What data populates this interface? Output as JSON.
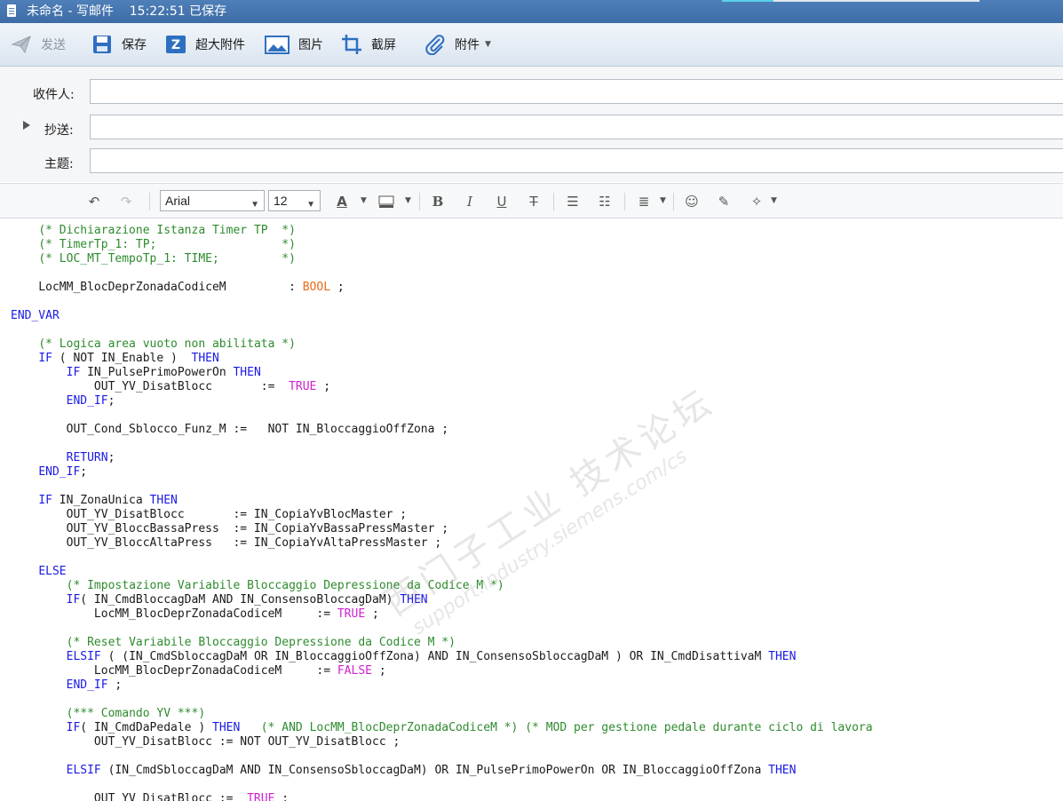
{
  "window": {
    "title": "未命名 - 写邮件",
    "saved_time": "15:22:51 已保存"
  },
  "toolbar": {
    "send": "发送",
    "save": "保存",
    "large_attachment": "超大附件",
    "image": "图片",
    "screenshot": "截屏",
    "attachment": "附件"
  },
  "fields": {
    "to_label": "收件人:",
    "cc_label": "抄送:",
    "subject_label": "主题:"
  },
  "format": {
    "font": "Arial",
    "size": "12"
  },
  "colors": {
    "comment": "#2e8b2e",
    "keyword": "#1a1ae6",
    "type": "#e86a1a",
    "value": "#d020d0"
  },
  "watermark": {
    "cn": "西门子工业 技术论坛",
    "url": "support.industry.siemens.com/cs"
  },
  "code": [
    {
      "segs": [
        [
          "    ",
          ""
        ],
        [
          "(* Dichiarazione Istanza Timer TP  *)",
          "c"
        ]
      ]
    },
    {
      "segs": [
        [
          "    ",
          ""
        ],
        [
          "(* TimerTp_1: TP;                  *)",
          "c"
        ]
      ]
    },
    {
      "segs": [
        [
          "    ",
          ""
        ],
        [
          "(* LOC_MT_TempoTp_1: TIME;         *)",
          "c"
        ]
      ]
    },
    {
      "segs": [
        [
          "",
          ""
        ]
      ]
    },
    {
      "segs": [
        [
          "    LocMM_BlocDeprZonadaCodiceM         : ",
          ""
        ],
        [
          "BOOL",
          "t"
        ],
        [
          " ;",
          ""
        ]
      ]
    },
    {
      "segs": [
        [
          "",
          ""
        ]
      ]
    },
    {
      "segs": [
        [
          "END_VAR",
          "k"
        ]
      ]
    },
    {
      "segs": [
        [
          "",
          ""
        ]
      ]
    },
    {
      "segs": [
        [
          "    ",
          ""
        ],
        [
          "(* Logica area vuoto non abilitata *)",
          "c"
        ]
      ]
    },
    {
      "segs": [
        [
          "    ",
          ""
        ],
        [
          "IF",
          "k"
        ],
        [
          " ( NOT IN_Enable )  ",
          ""
        ],
        [
          "THEN",
          "k"
        ]
      ]
    },
    {
      "segs": [
        [
          "        ",
          ""
        ],
        [
          "IF",
          "k"
        ],
        [
          " IN_PulsePrimoPowerOn ",
          ""
        ],
        [
          "THEN",
          "k"
        ]
      ]
    },
    {
      "segs": [
        [
          "            OUT_YV_DisatBlocc       :=  ",
          ""
        ],
        [
          "TRUE",
          "v"
        ],
        [
          " ;",
          ""
        ]
      ]
    },
    {
      "segs": [
        [
          "        ",
          ""
        ],
        [
          "END_IF",
          "k"
        ],
        [
          ";",
          ""
        ]
      ]
    },
    {
      "segs": [
        [
          "",
          ""
        ]
      ]
    },
    {
      "segs": [
        [
          "        OUT_Cond_Sblocco_Funz_M :=   NOT IN_BloccaggioOffZona ;",
          ""
        ]
      ]
    },
    {
      "segs": [
        [
          "",
          ""
        ]
      ]
    },
    {
      "segs": [
        [
          "        ",
          ""
        ],
        [
          "RETURN",
          "k"
        ],
        [
          ";",
          ""
        ]
      ]
    },
    {
      "segs": [
        [
          "    ",
          ""
        ],
        [
          "END_IF",
          "k"
        ],
        [
          ";",
          ""
        ]
      ]
    },
    {
      "segs": [
        [
          "",
          ""
        ]
      ]
    },
    {
      "segs": [
        [
          "    ",
          ""
        ],
        [
          "IF",
          "k"
        ],
        [
          " IN_ZonaUnica ",
          ""
        ],
        [
          "THEN",
          "k"
        ]
      ]
    },
    {
      "segs": [
        [
          "        OUT_YV_DisatBlocc       := IN_CopiaYvBlocMaster ;",
          ""
        ]
      ]
    },
    {
      "segs": [
        [
          "        OUT_YV_BloccBassaPress  := IN_CopiaYvBassaPressMaster ;",
          ""
        ]
      ]
    },
    {
      "segs": [
        [
          "        OUT_YV_BloccAltaPress   := IN_CopiaYvAltaPressMaster ;",
          ""
        ]
      ]
    },
    {
      "segs": [
        [
          "",
          ""
        ]
      ]
    },
    {
      "segs": [
        [
          "    ",
          ""
        ],
        [
          "ELSE",
          "k"
        ]
      ]
    },
    {
      "segs": [
        [
          "        ",
          ""
        ],
        [
          "(* Impostazione Variabile Bloccaggio Depressione da Codice M *)",
          "c"
        ]
      ]
    },
    {
      "segs": [
        [
          "        ",
          ""
        ],
        [
          "IF",
          "k"
        ],
        [
          "( IN_CmdBloccagDaM AND IN_ConsensoBloccagDaM) ",
          ""
        ],
        [
          "THEN",
          "k"
        ]
      ]
    },
    {
      "segs": [
        [
          "            LocMM_BlocDeprZonadaCodiceM     := ",
          ""
        ],
        [
          "TRUE",
          "v"
        ],
        [
          " ;",
          ""
        ]
      ]
    },
    {
      "segs": [
        [
          "",
          ""
        ]
      ]
    },
    {
      "segs": [
        [
          "        ",
          ""
        ],
        [
          "(* Reset Variabile Bloccaggio Depressione da Codice M *)",
          "c"
        ]
      ]
    },
    {
      "segs": [
        [
          "        ",
          ""
        ],
        [
          "ELSIF",
          "k"
        ],
        [
          " ( (IN_CmdSbloccagDaM OR IN_BloccaggioOffZona) AND IN_ConsensoSbloccagDaM ) OR IN_CmdDisattivaM ",
          ""
        ],
        [
          "THEN",
          "k"
        ]
      ]
    },
    {
      "segs": [
        [
          "            LocMM_BlocDeprZonadaCodiceM     := ",
          ""
        ],
        [
          "FALSE",
          "v"
        ],
        [
          " ;",
          ""
        ]
      ]
    },
    {
      "segs": [
        [
          "        ",
          ""
        ],
        [
          "END_IF",
          "k"
        ],
        [
          " ;",
          ""
        ]
      ]
    },
    {
      "segs": [
        [
          "",
          ""
        ]
      ]
    },
    {
      "segs": [
        [
          "        ",
          ""
        ],
        [
          "(*** Comando YV ***)",
          "c"
        ]
      ]
    },
    {
      "segs": [
        [
          "        ",
          ""
        ],
        [
          "IF",
          "k"
        ],
        [
          "( IN_CmdDaPedale ) ",
          ""
        ],
        [
          "THEN",
          "k"
        ],
        [
          "   ",
          ""
        ],
        [
          "(* AND LocMM_BlocDeprZonadaCodiceM *) (* MOD per gestione pedale durante ciclo di lavora",
          "c"
        ]
      ]
    },
    {
      "segs": [
        [
          "            OUT_YV_DisatBlocc := NOT OUT_YV_DisatBlocc ;",
          ""
        ]
      ]
    },
    {
      "segs": [
        [
          "",
          ""
        ]
      ]
    },
    {
      "segs": [
        [
          "        ",
          ""
        ],
        [
          "ELSIF",
          "k"
        ],
        [
          " (IN_CmdSbloccagDaM AND IN_ConsensoSbloccagDaM) OR IN_PulsePrimoPowerOn OR IN_BloccaggioOffZona ",
          ""
        ],
        [
          "THEN",
          "k"
        ]
      ]
    },
    {
      "segs": [
        [
          "",
          ""
        ]
      ]
    },
    {
      "segs": [
        [
          "            OUT_YV_DisatBlocc :=  ",
          ""
        ],
        [
          "TRUE",
          "v"
        ],
        [
          " ;",
          ""
        ]
      ]
    }
  ]
}
